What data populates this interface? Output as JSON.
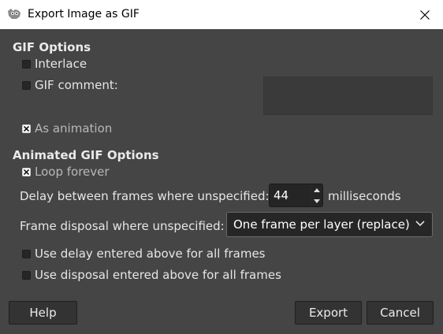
{
  "window": {
    "title": "Export Image as GIF"
  },
  "gif_options": {
    "heading": "GIF Options",
    "interlace": {
      "label": "Interlace",
      "checked": false
    },
    "gif_comment": {
      "label": "GIF comment:",
      "checked": false,
      "value": ""
    },
    "as_animation": {
      "label": "As animation",
      "checked": true
    }
  },
  "animated_options": {
    "heading": "Animated GIF Options",
    "loop_forever": {
      "label": "Loop forever",
      "checked": true
    },
    "delay": {
      "label": "Delay between frames where unspecified:",
      "value": "44",
      "unit": "milliseconds"
    },
    "disposal": {
      "label": "Frame disposal where unspecified:",
      "selected": "One frame per layer (replace)"
    },
    "use_delay_all": {
      "label": "Use delay entered above for all frames",
      "checked": false
    },
    "use_disposal_all": {
      "label": "Use disposal entered above for all frames",
      "checked": false
    }
  },
  "buttons": {
    "help": "Help",
    "export": "Export",
    "cancel": "Cancel"
  },
  "colors": {
    "background": "#454545",
    "titlebar": "#ffffff",
    "field": "#262626",
    "button": "#333333"
  },
  "icons": {
    "app": "gimp-wilber-icon",
    "close": "close-icon",
    "spin": "spin-arrows-icon",
    "dropdown": "chevron-down-icon",
    "checkmark": "x-check-icon"
  }
}
